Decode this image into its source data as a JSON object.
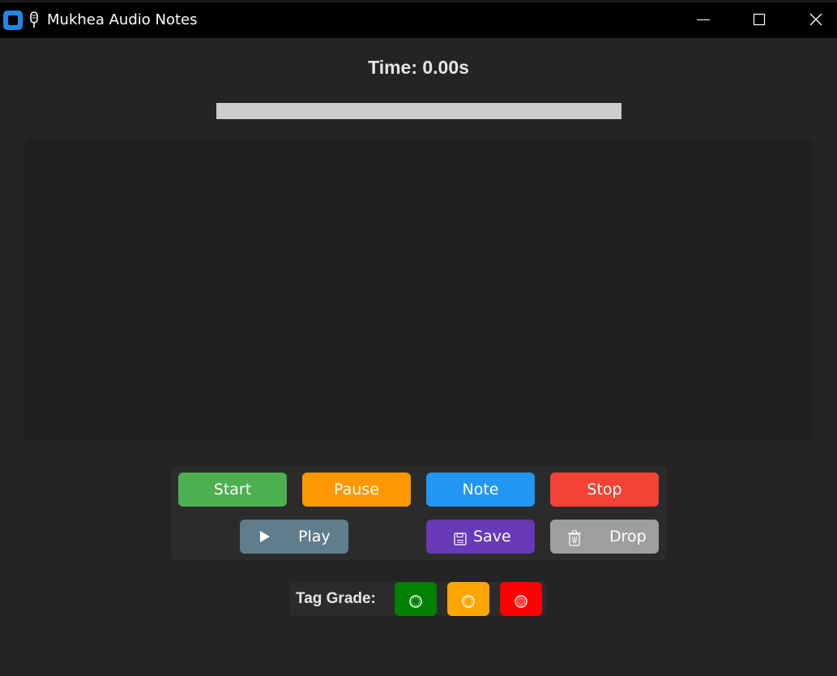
{
  "window": {
    "title": "Mukhea Audio Notes"
  },
  "timer": {
    "label": "Time: 0.00s",
    "progress_fraction": 0
  },
  "notes": {
    "text": ""
  },
  "controls": {
    "start": "Start",
    "pause": "Pause",
    "note": "Note",
    "stop": "Stop",
    "play": "Play",
    "save": "Save",
    "drop": "Drop"
  },
  "tags": {
    "label": "Tag Grade:",
    "grades": [
      {
        "color": "#008000"
      },
      {
        "color": "#ffa500"
      },
      {
        "color": "#ff0000"
      }
    ]
  },
  "colors": {
    "start": "#4caf50",
    "pause": "#ff9800",
    "note": "#2196f3",
    "stop": "#f44336",
    "play": "#607d8b",
    "save": "#673ab7",
    "drop": "#9e9e9e",
    "progress_track": "#cccccc",
    "background": "#242424"
  },
  "icons": {
    "app": "app-icon",
    "title": "microphone-icon",
    "play": "play-icon",
    "save": "floppy-disk-icon",
    "drop": "trash-icon",
    "grade": "circle-icon"
  }
}
